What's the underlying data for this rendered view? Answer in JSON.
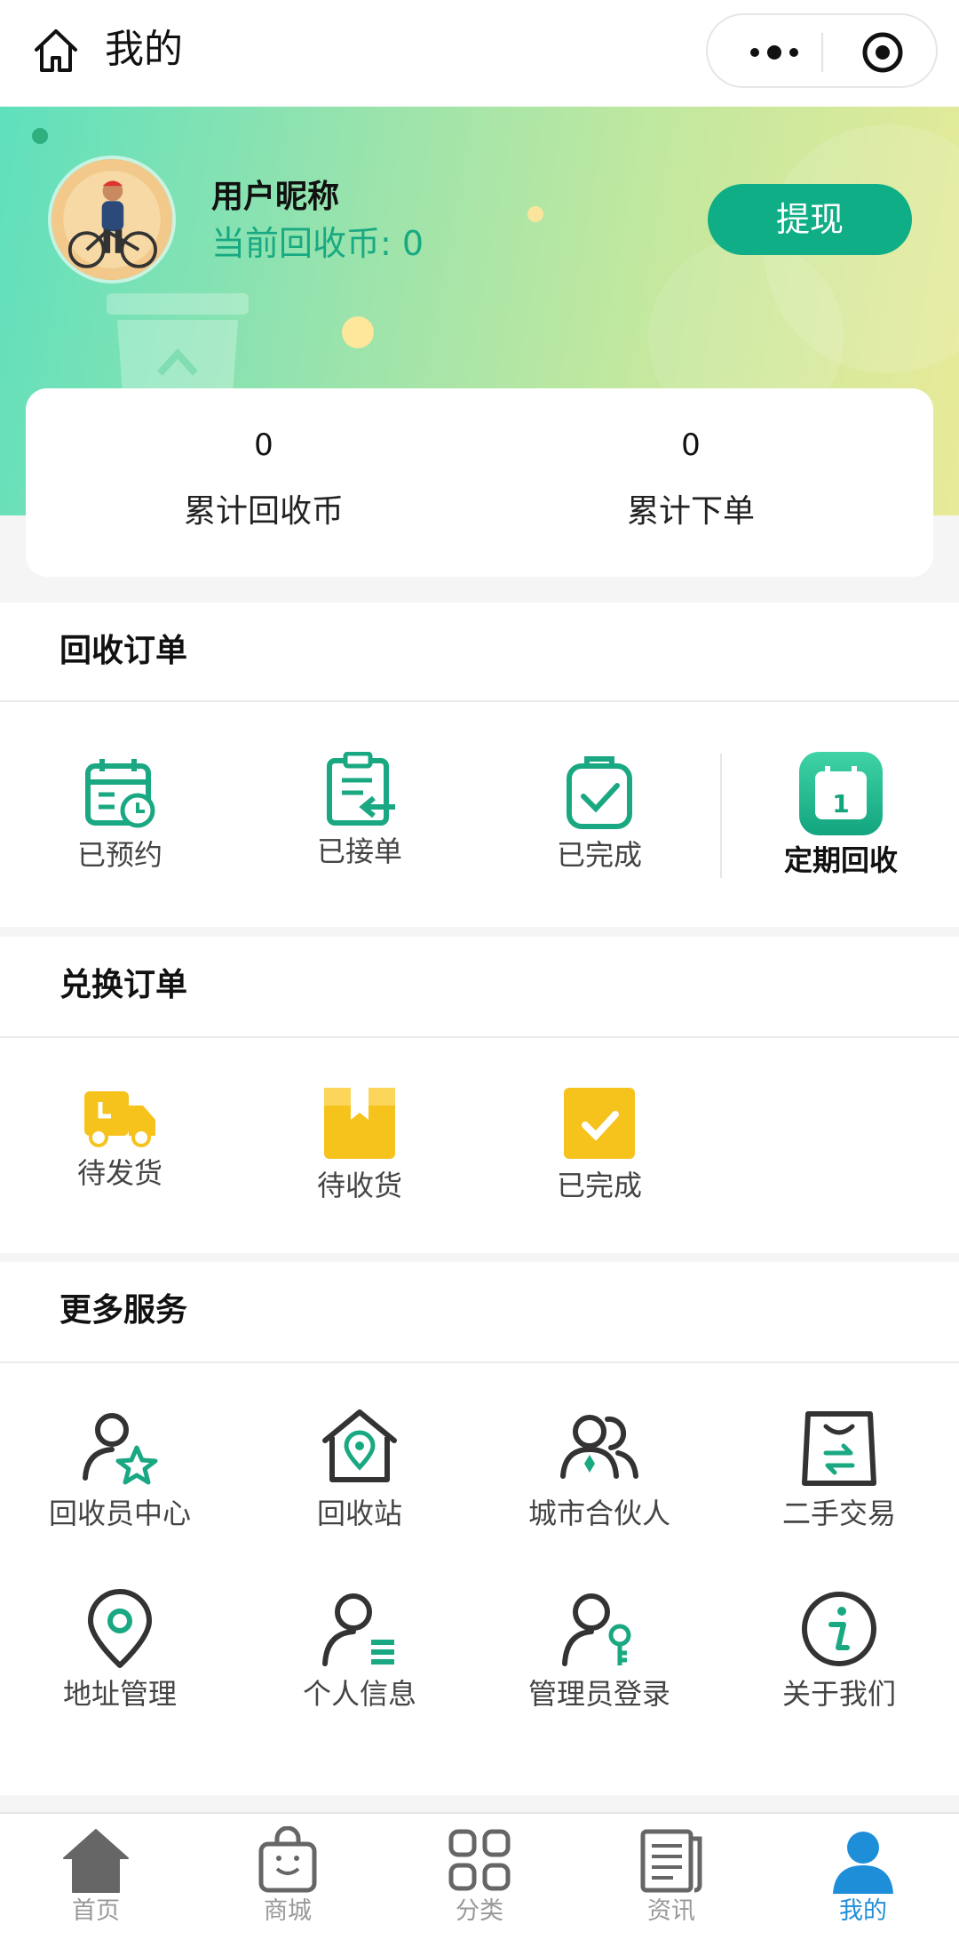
{
  "header": {
    "title": "我的"
  },
  "profile": {
    "nickname": "用户昵称",
    "coin_text": "当前回收币: 0",
    "withdraw_label": "提现"
  },
  "stats": [
    {
      "value": "0",
      "label": "累计回收币"
    },
    {
      "value": "0",
      "label": "累计下单"
    }
  ],
  "recycle_orders": {
    "title": "回收订单",
    "items": [
      {
        "label": "已预约",
        "icon": "calendar-clock-icon"
      },
      {
        "label": "已接单",
        "icon": "clipboard-return-icon"
      },
      {
        "label": "已完成",
        "icon": "clipboard-check-icon"
      },
      {
        "label": "定期回收",
        "icon": "calendar-one-icon"
      }
    ]
  },
  "exchange_orders": {
    "title": "兑换订单",
    "items": [
      {
        "label": "待发货",
        "icon": "truck-icon"
      },
      {
        "label": "待收货",
        "icon": "package-icon"
      },
      {
        "label": "已完成",
        "icon": "checkbox-icon"
      }
    ]
  },
  "more_services": {
    "title": "更多服务",
    "items": [
      {
        "label": "回收员中心",
        "icon": "person-star-icon"
      },
      {
        "label": "回收站",
        "icon": "house-location-icon"
      },
      {
        "label": "城市合伙人",
        "icon": "partners-icon"
      },
      {
        "label": "二手交易",
        "icon": "shopping-bag-icon"
      },
      {
        "label": "地址管理",
        "icon": "location-pin-icon"
      },
      {
        "label": "个人信息",
        "icon": "person-list-icon"
      },
      {
        "label": "管理员登录",
        "icon": "person-key-icon"
      },
      {
        "label": "关于我们",
        "icon": "info-icon"
      }
    ]
  },
  "tabbar": {
    "items": [
      {
        "label": "首页",
        "icon": "home-icon"
      },
      {
        "label": "商城",
        "icon": "shopping-bag-icon"
      },
      {
        "label": "分类",
        "icon": "grid-icon"
      },
      {
        "label": "资讯",
        "icon": "news-icon"
      },
      {
        "label": "我的",
        "icon": "user-icon"
      }
    ],
    "active_index": 4
  },
  "colors": {
    "accent_green": "#0fae86",
    "icon_teal": "#1aa883",
    "icon_yellow": "#f6c21c",
    "tab_active": "#1f8ed8"
  }
}
